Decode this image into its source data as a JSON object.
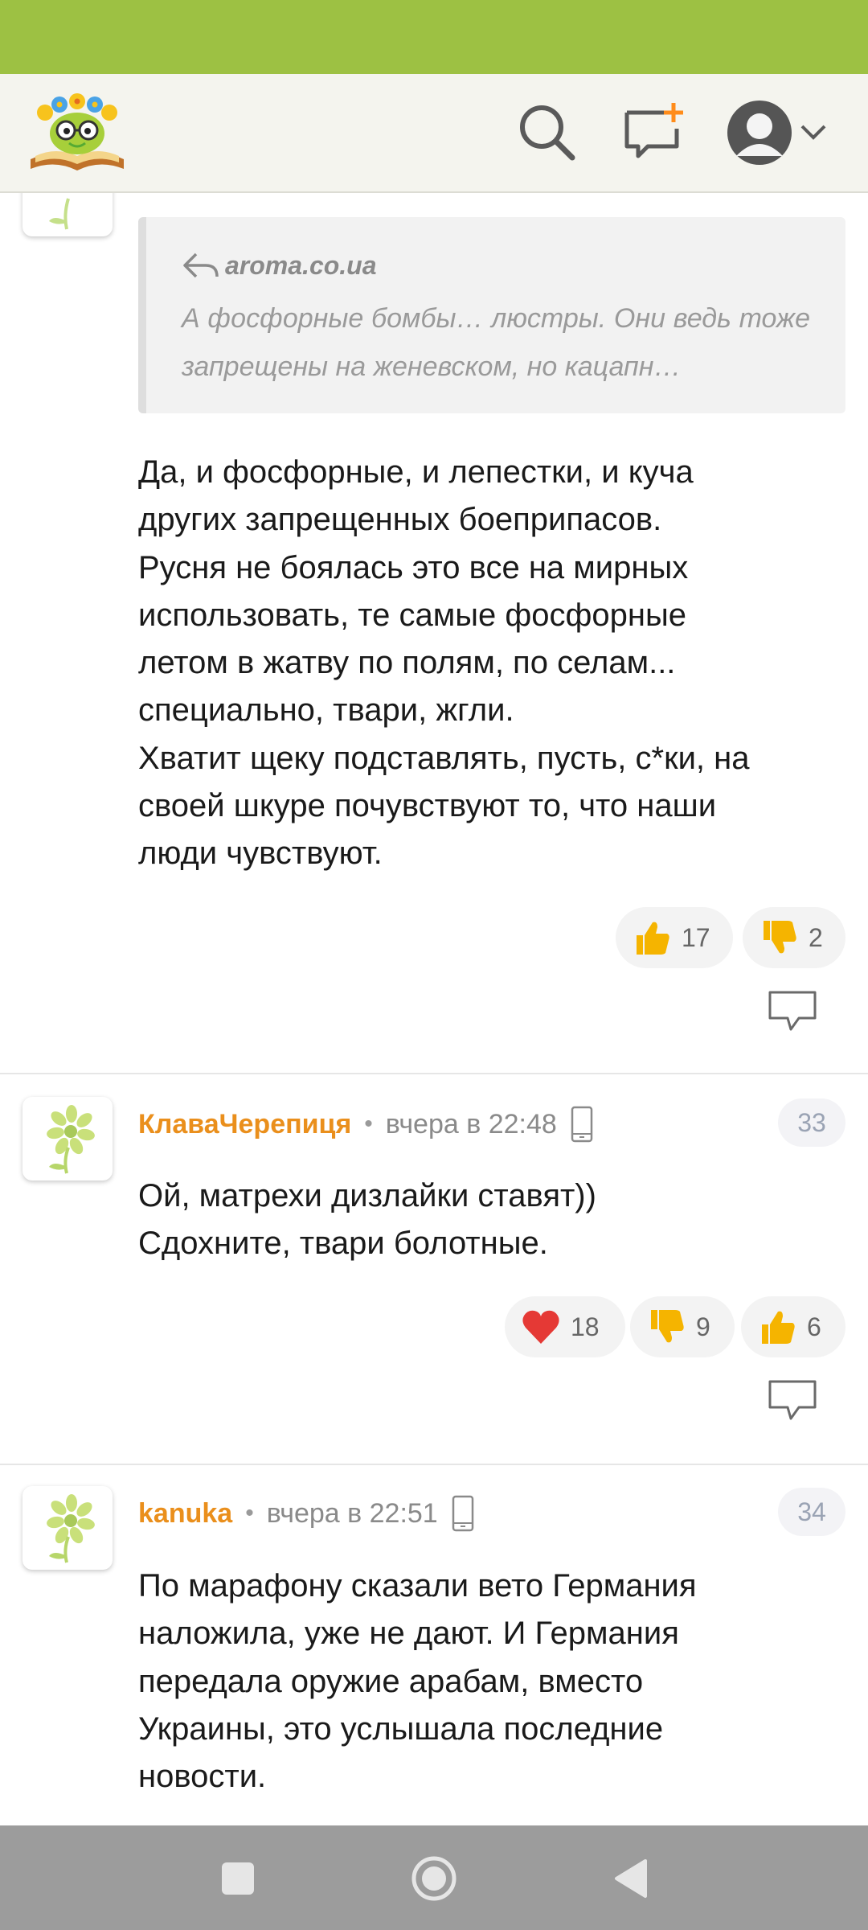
{
  "header": {
    "logo_icon": "flower-crowned-book-logo",
    "search_icon": "search-icon",
    "new_post_icon": "message-plus-icon",
    "profile_icon": "user-avatar-icon",
    "dropdown_icon": "chevron-down-icon",
    "accent_color": "#9dc143"
  },
  "comments": [
    {
      "quote": {
        "source": "aroma.co.ua",
        "text": "А фосфорные бомбы… люстры. Они ведь тоже запрещены на женевском, но кацапн…"
      },
      "lines": [
        "Да, и фосфорные, и лепестки, и куча",
        "других запрещенных боеприпасов.",
        "Русня не боялась это все на мирных",
        "использовать, те самые фосфорные",
        "летом в жатву по полям, по селам...",
        "специально, твари, жгли.",
        "Хватит щеку подставлять, пусть, с*ки, на",
        "своей шкуре почувствуют то, что наши",
        "люди чувствуют."
      ],
      "reactions": [
        {
          "icon": "thumbs-up-icon",
          "count": "17"
        },
        {
          "icon": "thumbs-down-icon",
          "count": "2"
        }
      ]
    },
    {
      "author": "КлаваЧерепиця",
      "time": "вчера в 22:48",
      "number": "33",
      "lines": [
        "Ой, матрехи дизлайки ставят))",
        "Сдохните, твари болотные."
      ],
      "reactions": [
        {
          "icon": "heart-icon",
          "count": "18"
        },
        {
          "icon": "thumbs-down-icon",
          "count": "9"
        },
        {
          "icon": "thumbs-up-icon",
          "count": "6"
        }
      ]
    },
    {
      "author": "kanuka",
      "time": "вчера в 22:51",
      "number": "34",
      "lines": [
        "По марафону сказали вето Германия",
        "наложила, уже не дают. И Германия",
        "передала оружие арабам, вместо",
        "Украины, это услышала последние",
        "новости."
      ]
    }
  ],
  "colors": {
    "author": "#ea8f1c",
    "like": "#f5b400",
    "heart": "#e53935"
  }
}
